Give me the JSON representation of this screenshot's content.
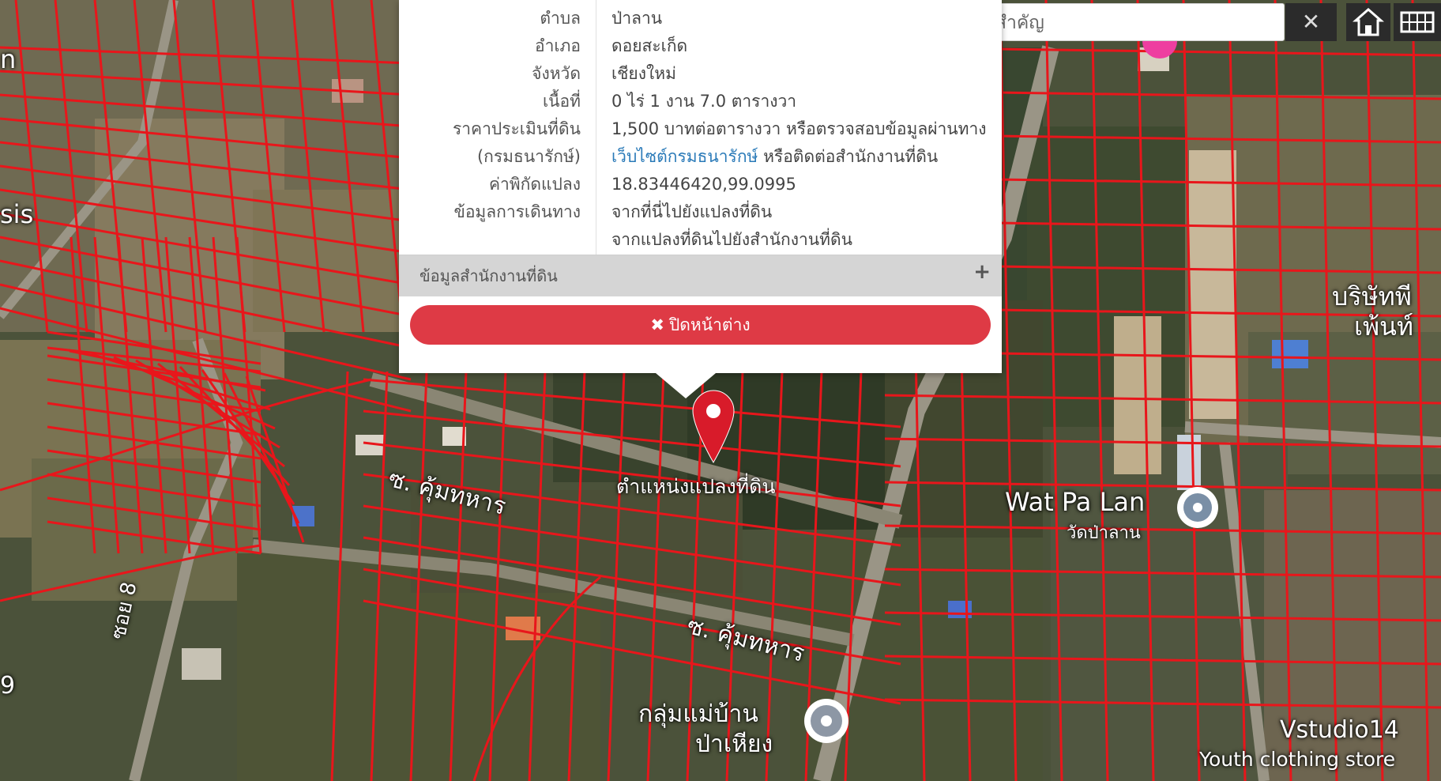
{
  "popup": {
    "rows": [
      {
        "label": "ตำบล",
        "value": "ป่าลาน"
      },
      {
        "label": "อำเภอ",
        "value": "ดอยสะเก็ด"
      },
      {
        "label": "จังหวัด",
        "value": "เชียงใหม่"
      },
      {
        "label": "เนื้อที่",
        "value": "0 ไร่ 1 งาน 7.0 ตารางวา"
      },
      {
        "label": "ราคาประเมินที่ดิน",
        "value": "1,500 บาทต่อตารางวา หรือตรวจสอบข้อมูลผ่านทาง"
      },
      {
        "label": "(กรมธนารักษ์)",
        "value_link": "เว็บไซต์กรมธนารักษ์",
        "value_rest": " หรือติดต่อสำนักงานที่ดิน"
      },
      {
        "label": "ค่าพิกัดแปลง",
        "value": "18.83446420,99.0995"
      },
      {
        "label": "ข้อมูลการเดินทาง",
        "value": "จากที่นี่ไปยังแปลงที่ดิน"
      },
      {
        "label": "",
        "value": "จากแปลงที่ดินไปยังสำนักงานที่ดิน"
      }
    ],
    "section_title": "ข้อมูลสำนักงานที่ดิน",
    "section_toggle": "+",
    "close_label": "ปิดหน้าต่าง",
    "close_icon": "✖"
  },
  "search": {
    "placeholder": "ค้นหาสถานที่สำคัญ",
    "clear_label": "✕"
  },
  "icons": {
    "home": "home-icon",
    "grid": "grid-icon",
    "marker": "map-pin-icon"
  },
  "map_labels": {
    "marker": "ตำแหน่งแปลงที่ดิน",
    "road_1": "ซ. คุ้มทหาร",
    "road_2": "ซ. คุ้มทหาร",
    "soi": "ซอย 8",
    "wat_en": "Wat Pa Lan",
    "wat_th": "วัดป่าลาน",
    "community_1": "กลุ่มแม่บ้าน",
    "community_2": "ป่าเหียง",
    "shop_1": "Vstudio14",
    "shop_2": "Youth clothing store",
    "company_1": "บริษัทพี",
    "company_2": "เพ้นท์",
    "edge_1": "sis",
    "edge_2": "n",
    "edge_3": "9"
  },
  "colors": {
    "accent": "#de3a45",
    "link": "#2a7ab8",
    "parcel": "#e8161b"
  }
}
